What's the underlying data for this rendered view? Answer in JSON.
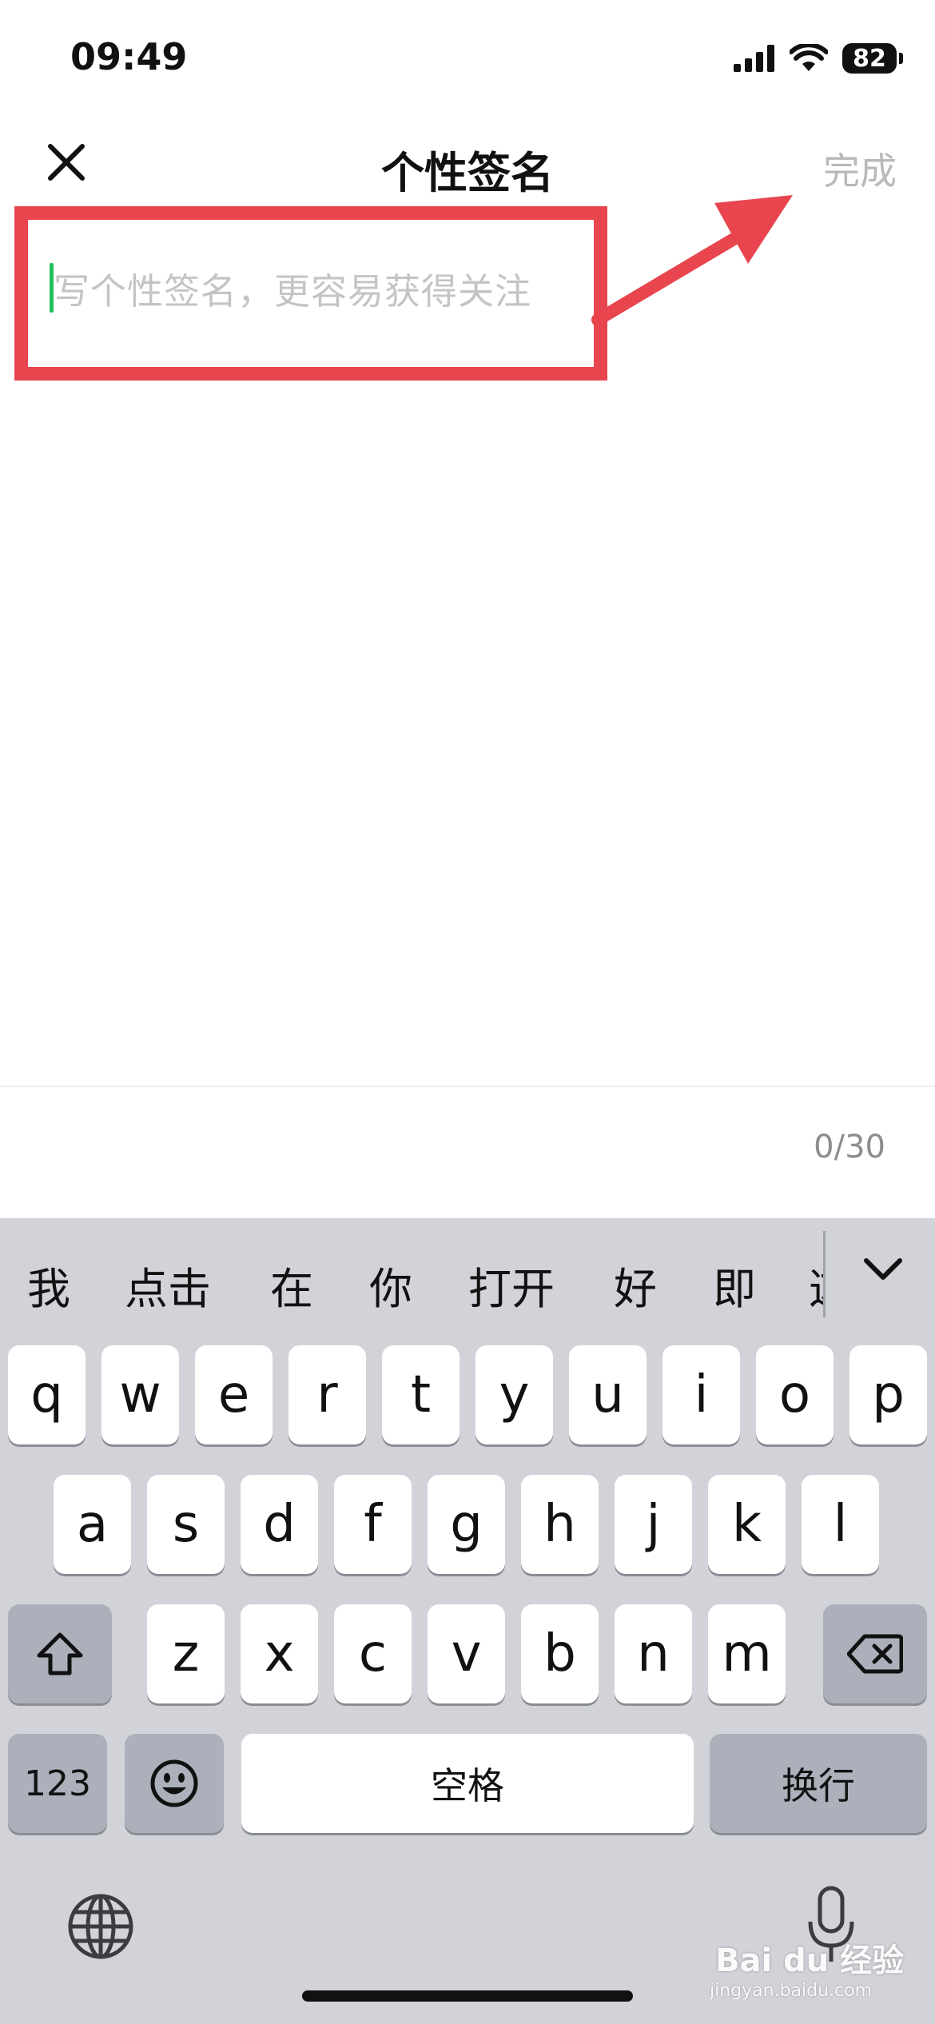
{
  "status_bar": {
    "time": "09:49",
    "battery": "82",
    "icons": [
      "cellular-signal-icon",
      "wifi-icon",
      "battery-icon"
    ]
  },
  "nav": {
    "title": "个性签名",
    "done_label": "完成",
    "close_icon": "close-icon"
  },
  "editor": {
    "placeholder": "写个性签名，更容易获得关注",
    "value": ""
  },
  "counter": "0/30",
  "keyboard": {
    "candidates": [
      "我",
      "点击",
      "在",
      "你",
      "打开",
      "好",
      "即",
      "这"
    ],
    "row1": [
      "q",
      "w",
      "e",
      "r",
      "t",
      "y",
      "u",
      "i",
      "o",
      "p"
    ],
    "row2": [
      "a",
      "s",
      "d",
      "f",
      "g",
      "h",
      "j",
      "k",
      "l"
    ],
    "row3": [
      "z",
      "x",
      "c",
      "v",
      "b",
      "n",
      "m"
    ],
    "numbers_label": "123",
    "space_label": "空格",
    "return_label": "换行"
  },
  "watermark": {
    "brand": "Bai du 经验",
    "url": "jingyan.baidu.com"
  },
  "colors": {
    "annotation": "#e8454f",
    "caret": "#21c05a",
    "keyboard_bg": "#d1d3d9",
    "placeholder": "#c4c4c4"
  }
}
